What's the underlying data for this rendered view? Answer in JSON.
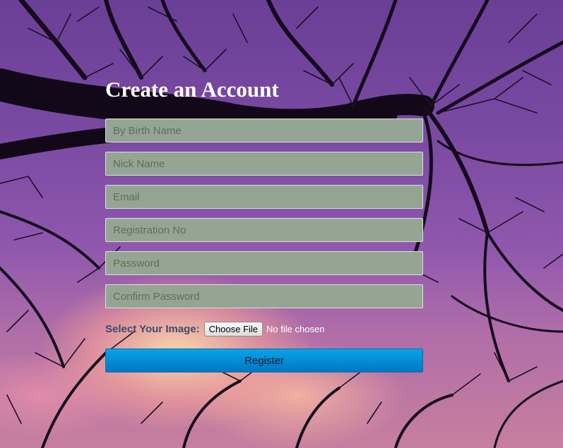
{
  "page": {
    "title": "Create an Account"
  },
  "form": {
    "fields": [
      {
        "placeholder": "By Birth Name",
        "value": ""
      },
      {
        "placeholder": "Nick Name",
        "value": ""
      },
      {
        "placeholder": "Email",
        "value": ""
      },
      {
        "placeholder": "Registration No",
        "value": ""
      },
      {
        "placeholder": "Password",
        "value": ""
      },
      {
        "placeholder": "Confirm Password",
        "value": ""
      }
    ],
    "image_label": "Select Your Image:",
    "file_button_label": "Choose File",
    "file_status": "No file chosen",
    "submit_label": "Register"
  },
  "colors": {
    "input_bg": "#94a693",
    "button_gradient_top": "#0aa3e8",
    "button_gradient_bottom": "#0077c2",
    "label": "#3b4d6e",
    "title": "#ffffff"
  },
  "background": {
    "icon": "bare-tree-branches-sunset-image"
  }
}
